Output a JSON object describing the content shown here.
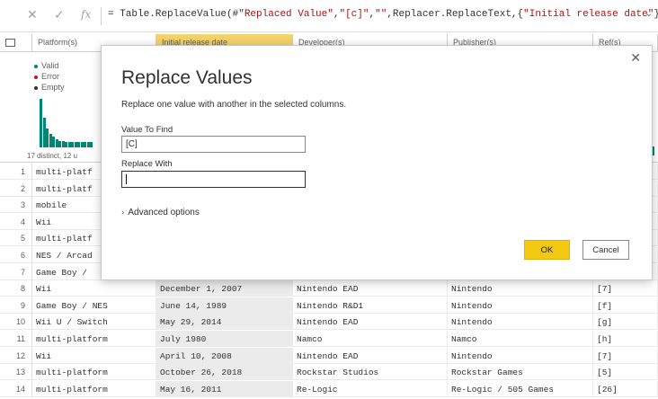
{
  "formula_bar": {
    "cancel_icon": "✕",
    "accept_icon": "✓",
    "fx_icon": "fx",
    "prefix": "= Table.ReplaceValue(#",
    "str1": "\"Replaced Value\"",
    "comma1": ",",
    "str2": "\"[c]\"",
    "comma2": ",",
    "str3": "\"\"",
    "mid": ",Replacer.ReplaceText,{",
    "str4": "\"Initial release date\"",
    "suffix": "})",
    "chevron": "⌄"
  },
  "columns": [
    {
      "label": "Platform(s)"
    },
    {
      "label": "Initial release date"
    },
    {
      "label": "Developer(s)"
    },
    {
      "label": "Publisher(s)"
    },
    {
      "label": "Ref(s)"
    }
  ],
  "profile": {
    "legend": [
      "Valid",
      "Error",
      "Empty"
    ],
    "legend_colors": [
      "#018574",
      "#c50f1f",
      "#323130"
    ],
    "distinct": "17 distinct, 12 u",
    "histogram": [
      0.9,
      0.55,
      0.35,
      0.25,
      0.2,
      0.15,
      0.12,
      0.12,
      0.1,
      0.1,
      0.1,
      0.1,
      0.1,
      0.1,
      0.1,
      0.1,
      0.1
    ]
  },
  "rows": [
    {
      "num": "1",
      "platform": "multi-platf",
      "date": "",
      "dev": "",
      "pub": "",
      "ref": ""
    },
    {
      "num": "2",
      "platform": "multi-platf",
      "date": "",
      "dev": "",
      "pub": "",
      "ref": ""
    },
    {
      "num": "3",
      "platform": "mobile",
      "date": "",
      "dev": "",
      "pub": "",
      "ref": ""
    },
    {
      "num": "4",
      "platform": "Wii",
      "date": "",
      "dev": "",
      "pub": "",
      "ref": ""
    },
    {
      "num": "5",
      "platform": "multi-platf",
      "date": "",
      "dev": "",
      "pub": "",
      "ref": ""
    },
    {
      "num": "6",
      "platform": "NES / Arcad",
      "date": "",
      "dev": "",
      "pub": "",
      "ref": ""
    },
    {
      "num": "7",
      "platform": "Game Boy /",
      "date": "",
      "dev": "",
      "pub": "",
      "ref": ""
    },
    {
      "num": "8",
      "platform": "Wii",
      "date": "December 1, 2007",
      "dev": "Nintendo EAD",
      "pub": "Nintendo",
      "ref": "[7]"
    },
    {
      "num": "9",
      "platform": "Game Boy / NES",
      "date": "June 14, 1989",
      "dev": "Nintendo R&D1",
      "pub": "Nintendo",
      "ref": "[f]"
    },
    {
      "num": "10",
      "platform": "Wii U / Switch",
      "date": "May 29, 2014",
      "dev": "Nintendo EAD",
      "pub": "Nintendo",
      "ref": "[g]"
    },
    {
      "num": "11",
      "platform": "multi-platform",
      "date": "July 1980",
      "dev": "Namco",
      "pub": "Namco",
      "ref": "[h]"
    },
    {
      "num": "12",
      "platform": "Wii",
      "date": "April 10, 2008",
      "dev": "Nintendo EAD",
      "pub": "Nintendo",
      "ref": "[7]"
    },
    {
      "num": "13",
      "platform": "multi-platform",
      "date": "October 26, 2018",
      "dev": "Rockstar Studios",
      "pub": "Rockstar Games",
      "ref": "[5]"
    },
    {
      "num": "14",
      "platform": "multi-platform",
      "date": "May 16, 2011",
      "dev": "Re-Logic",
      "pub": "Re-Logic / 505 Games",
      "ref": "[26]"
    }
  ],
  "dialog": {
    "close_icon": "✕",
    "title": "Replace Values",
    "description": "Replace one value with another in the selected columns.",
    "find_label": "Value To Find",
    "find_value": "[C]",
    "replace_label": "Replace With",
    "replace_value": "",
    "advanced_label": "Advanced options",
    "advanced_chevron": "›",
    "ok_label": "OK",
    "cancel_label": "Cancel"
  }
}
